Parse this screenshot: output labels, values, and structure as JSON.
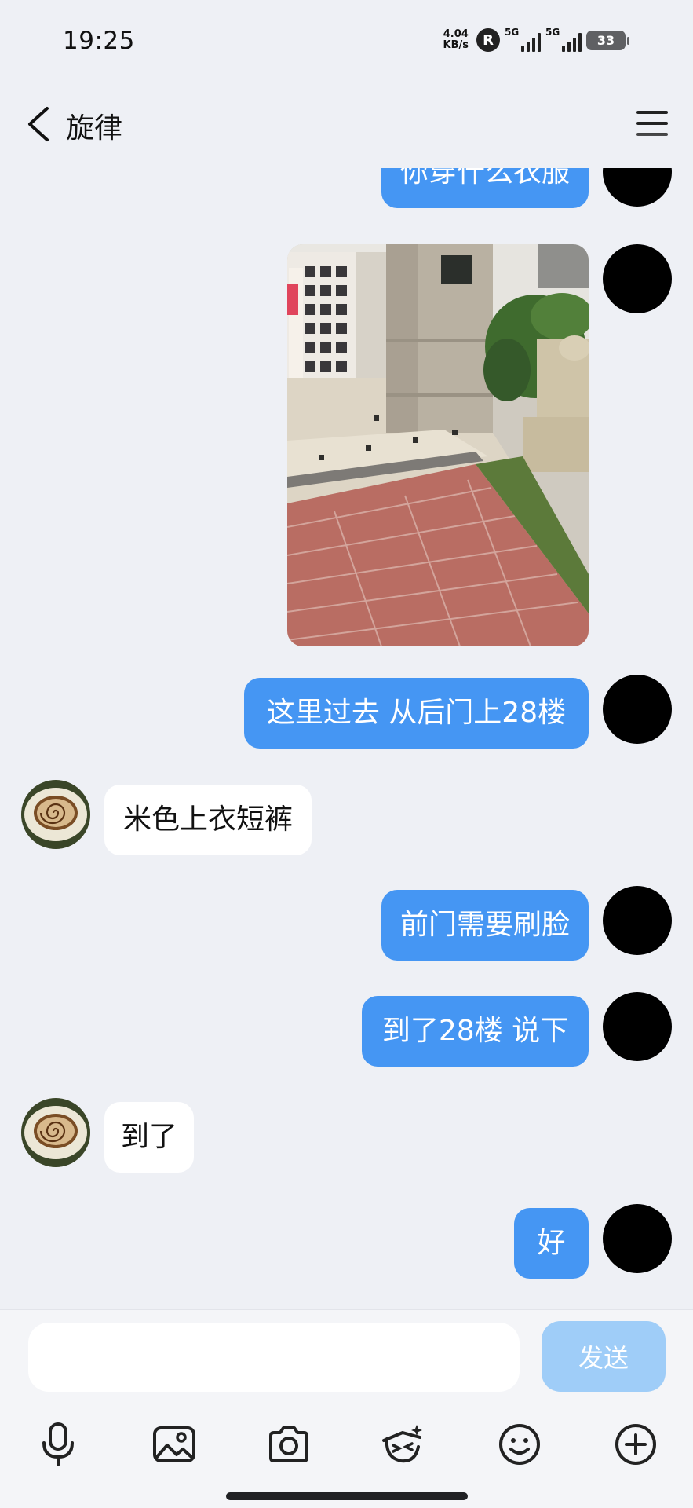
{
  "status": {
    "time": "19:25",
    "network_speed": "4.04",
    "network_speed_unit": "KB/s",
    "roaming_badge": "R",
    "signal_1": "5G",
    "signal_2": "5G",
    "battery": "33"
  },
  "header": {
    "title": "旋律",
    "back_icon": "back-arrow-icon",
    "menu_icon": "hamburger-menu-icon"
  },
  "messages": [
    {
      "type": "text",
      "direction": "outgoing",
      "text": "你穿什么衣服"
    },
    {
      "type": "image",
      "direction": "outgoing"
    },
    {
      "type": "text",
      "direction": "outgoing",
      "text": "这里过去 从后门上28楼"
    },
    {
      "type": "text",
      "direction": "incoming",
      "text": "米色上衣短裤"
    },
    {
      "type": "text",
      "direction": "outgoing",
      "text": "前门需要刷脸"
    },
    {
      "type": "text",
      "direction": "outgoing",
      "text": "到了28楼 说下"
    },
    {
      "type": "text",
      "direction": "incoming",
      "text": "到了"
    },
    {
      "type": "text",
      "direction": "outgoing",
      "text": "好"
    }
  ],
  "input": {
    "value": "",
    "placeholder": "",
    "send_label": "发送"
  },
  "toolbar": [
    {
      "icon": "microphone-icon"
    },
    {
      "icon": "image-icon"
    },
    {
      "icon": "camera-icon"
    },
    {
      "icon": "sticker-icon"
    },
    {
      "icon": "emoji-icon"
    },
    {
      "icon": "plus-circle-icon"
    }
  ],
  "colors": {
    "background": "#eef0f5",
    "outgoing_bubble": "#4596f3",
    "incoming_bubble": "#ffffff",
    "send_button": "#9fcdf8"
  }
}
